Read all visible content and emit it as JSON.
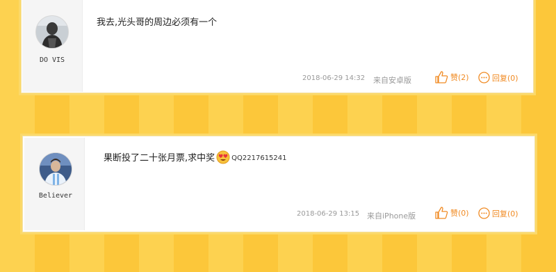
{
  "comments": [
    {
      "username": "DO VIS",
      "text": "我去,光头哥的周边必须有一个",
      "timestamp": "2018-06-29 14:32",
      "source": "来自安卓版",
      "like_label": "赞(2)",
      "reply_label": "回复(0)",
      "avatar_icon": "bald-man-avatar"
    },
    {
      "username": "Believer",
      "text": "果断投了二十张月票,求中奖",
      "emoji_icon": "heart-eyes-emoji",
      "qq_text": "QQ2217615241",
      "timestamp": "2018-06-29 13:15",
      "source": "来自iPhone版",
      "like_label": "赞(0)",
      "reply_label": "回复(0)",
      "avatar_icon": "footballer-avatar"
    }
  ],
  "colors": {
    "accent": "#f08a22",
    "background_stripe_light": "#fdd250",
    "background_stripe_dark": "#fcc73a",
    "meta_text": "#999999"
  }
}
